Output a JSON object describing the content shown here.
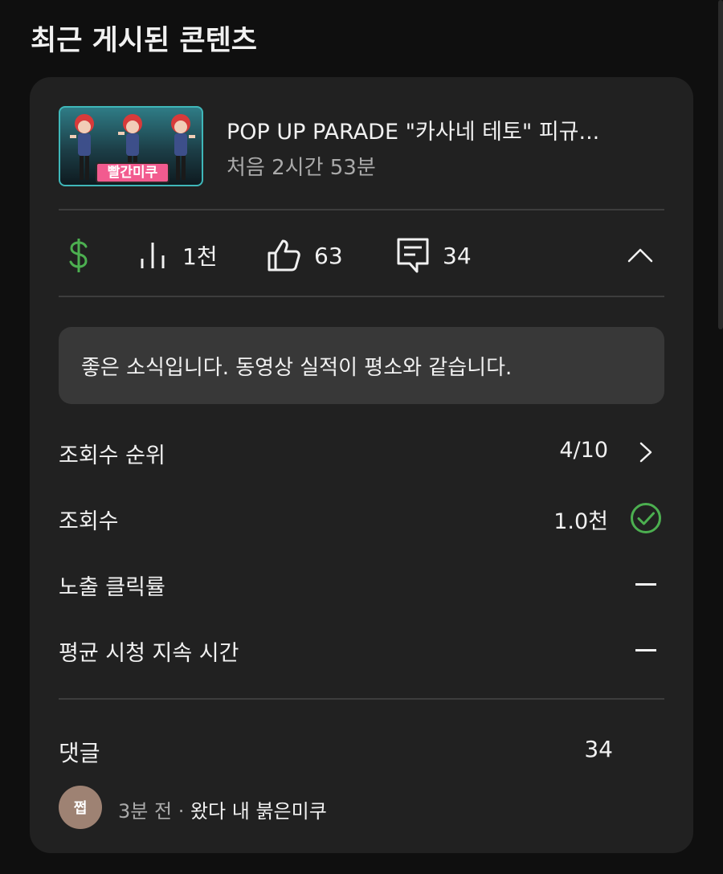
{
  "section_title": "최근 게시된 콘텐츠",
  "video": {
    "title": "POP UP PARADE \"카사네 테토\" 피규...",
    "subtitle": "처음 2시간 53분",
    "thumbnail_caption": "빨간미쿠"
  },
  "stats": {
    "monetization_icon": "dollar-icon",
    "views": "1천",
    "likes": "63",
    "comments": "34",
    "colors": {
      "dollar": "#4caf50"
    }
  },
  "banner_text": "좋은 소식입니다. 동영상 실적이 평소와 같습니다.",
  "metrics": [
    {
      "label": "조회수 순위",
      "value": "4/10",
      "trail": "chevron-right-icon"
    },
    {
      "label": "조회수",
      "value": "1.0천",
      "trail": "check-circle-icon"
    },
    {
      "label": "노출 클릭률",
      "value": "",
      "trail": "dash"
    },
    {
      "label": "평균 시청 지속 시간",
      "value": "",
      "trail": "dash"
    }
  ],
  "comments_section": {
    "label": "댓글",
    "count": "34"
  },
  "latest_comment": {
    "avatar_text": "쩝",
    "time": "3분 전",
    "separator": " · ",
    "text": "왔다 내 붉은미쿠"
  }
}
